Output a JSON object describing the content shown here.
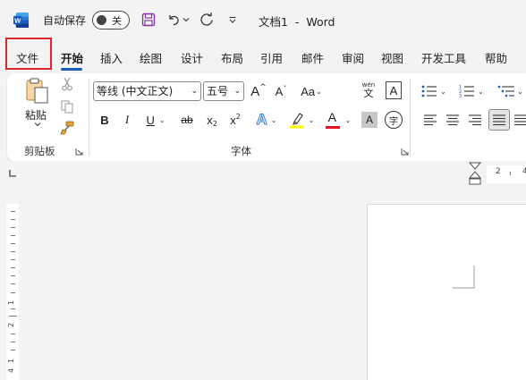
{
  "titlebar": {
    "autosave_label": "自动保存",
    "autosave_state": "关",
    "doc_title": "文档1  -  Word"
  },
  "tabs": [
    "文件",
    "开始",
    "插入",
    "绘图",
    "设计",
    "布局",
    "引用",
    "邮件",
    "审阅",
    "视图",
    "开发工具",
    "帮助"
  ],
  "ribbon": {
    "clipboard": {
      "paste_label": "粘贴",
      "group_label": "剪贴板"
    },
    "font": {
      "font_name": "等线 (中文正文)",
      "font_size": "五号",
      "group_label": "字体",
      "pinyin_top": "wén",
      "pinyin_bottom": "文",
      "case_label": "Aa",
      "bold": "B",
      "italic": "I",
      "underline": "U",
      "strike": "ab",
      "subscript_base": "x",
      "subscript_mark": "2",
      "superscript_base": "x",
      "superscript_mark": "2",
      "grow_label": "A",
      "shrink_label": "A",
      "effect_label": "A",
      "color_label": "A",
      "shade_label": "A",
      "border_label": "A",
      "circle_label": "字"
    }
  },
  "ruler": {
    "h_marks": [
      "2",
      "4"
    ],
    "v_marks": [
      "1",
      "2",
      "1",
      "4"
    ]
  },
  "colors": {
    "accent": "#185abd",
    "highlight": "#e0262c",
    "word_blue": "#185abd",
    "highlighter_yellow": "#ffff00",
    "font_red": "#e81123"
  }
}
